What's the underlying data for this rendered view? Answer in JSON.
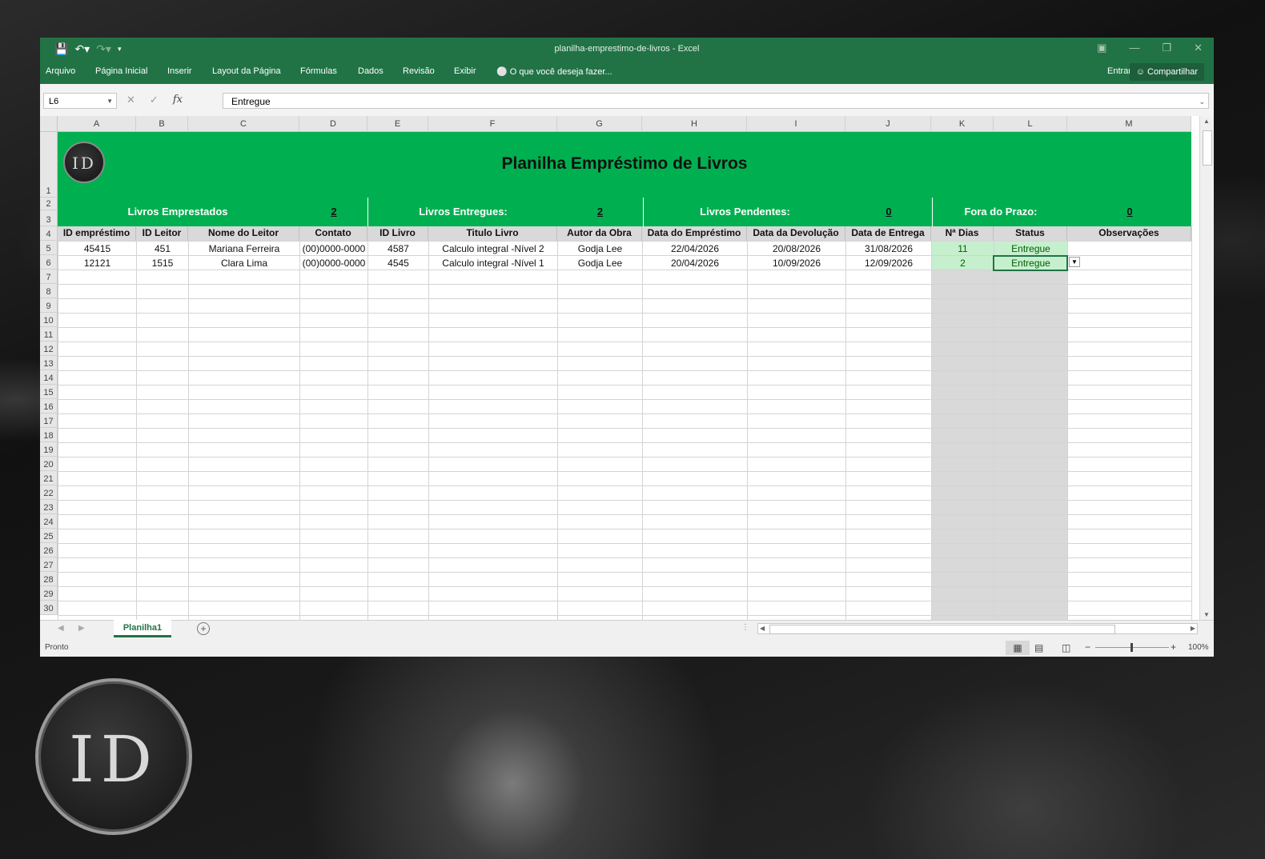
{
  "window": {
    "title": "planilha-emprestimo-de-livros - Excel"
  },
  "ribbon": {
    "tabs": [
      "Arquivo",
      "Página Inicial",
      "Inserir",
      "Layout da Página",
      "Fórmulas",
      "Dados",
      "Revisão",
      "Exibir"
    ],
    "tell_me": "O que você deseja fazer...",
    "sign_in": "Entrar",
    "share": "Compartilhar"
  },
  "formula_bar": {
    "name_box": "L6",
    "content": "Entregue"
  },
  "columns": [
    "A",
    "B",
    "C",
    "D",
    "E",
    "F",
    "G",
    "H",
    "I",
    "J",
    "K",
    "L",
    "M"
  ],
  "rows": [
    "1",
    "2",
    "3",
    "4",
    "5",
    "6",
    "7",
    "8",
    "9",
    "10",
    "11",
    "12",
    "13",
    "14",
    "15",
    "16",
    "17",
    "18",
    "19",
    "20",
    "21",
    "22",
    "23",
    "24",
    "25",
    "26",
    "27",
    "28",
    "29",
    "30"
  ],
  "sheet": {
    "logo_text": "ID",
    "title": "Planilha Empréstimo de Livros",
    "stats": [
      {
        "label": "Livros Emprestados",
        "value": "2"
      },
      {
        "label": "Livros Entregues:",
        "value": "2"
      },
      {
        "label": "Livros Pendentes:",
        "value": "0"
      },
      {
        "label": "Fora do Prazo:",
        "value": "0"
      }
    ],
    "headers": [
      "ID empréstimo",
      "ID Leitor",
      "Nome do Leitor",
      "Contato",
      "ID Livro",
      "Titulo Livro",
      "Autor da Obra",
      "Data do Empréstimo",
      "Data da Devolução",
      "Data de Entrega",
      "Nª Dias",
      "Status",
      "Observações"
    ],
    "records": [
      [
        "45415",
        "451",
        "Mariana Ferreira",
        "(00)0000-0000",
        "4587",
        "Calculo integral -Nível 2",
        "Godja Lee",
        "22/04/2026",
        "20/08/2026",
        "31/08/2026",
        "11",
        "Entregue",
        ""
      ],
      [
        "12121",
        "1515",
        "Clara Lima",
        "(00)0000-0000",
        "4545",
        "Calculo integral -Nível 1",
        "Godja Lee",
        "20/04/2026",
        "10/09/2026",
        "12/09/2026",
        "2",
        "Entregue",
        ""
      ]
    ]
  },
  "sheet_tabs": [
    "Planilha1"
  ],
  "status": {
    "mode": "Pronto",
    "zoom": "100%"
  },
  "background_logo": "ID",
  "colors": {
    "excel_green": "#217346",
    "banner_green": "#00b050",
    "status_fill": "#c6efce",
    "status_text": "#006100"
  }
}
